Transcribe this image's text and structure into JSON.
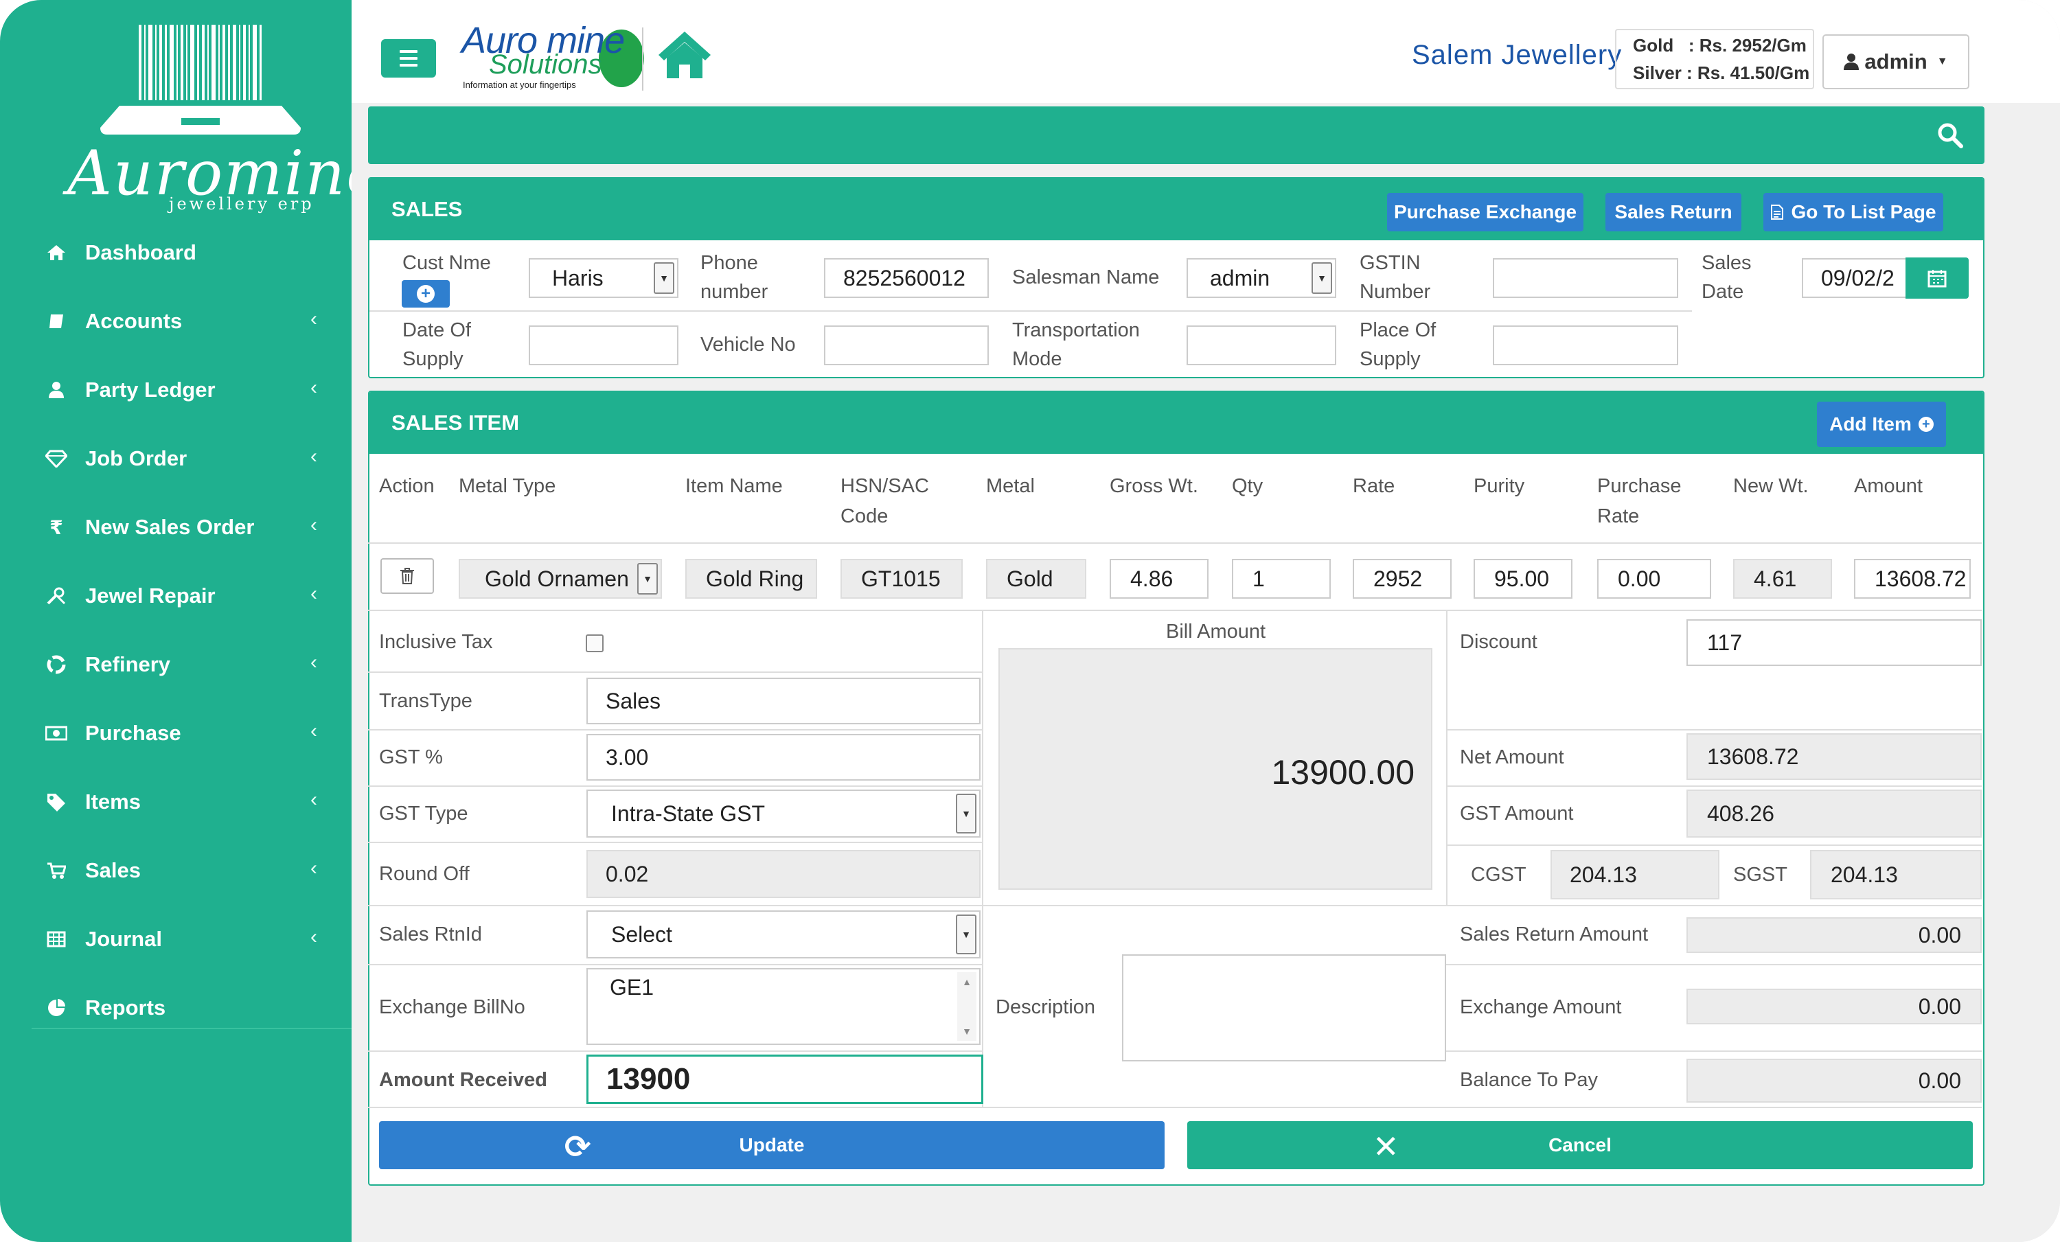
{
  "sidebar": {
    "brand": "Auromine",
    "brand_sub": "jewellery erp",
    "items": [
      {
        "label": "Dashboard",
        "icon": "home-icon"
      },
      {
        "label": "Accounts",
        "icon": "book-icon"
      },
      {
        "label": "Party Ledger",
        "icon": "user-icon"
      },
      {
        "label": "Job Order",
        "icon": "diamond-icon"
      },
      {
        "label": "New Sales Order",
        "icon": "rupee-icon"
      },
      {
        "label": "Jewel Repair",
        "icon": "tools-icon"
      },
      {
        "label": "Refinery",
        "icon": "recycle-icon"
      },
      {
        "label": "Purchase",
        "icon": "money-icon"
      },
      {
        "label": "Items",
        "icon": "tags-icon"
      },
      {
        "label": "Sales",
        "icon": "cart-icon"
      },
      {
        "label": "Journal",
        "icon": "table-icon"
      },
      {
        "label": "Reports",
        "icon": "pie-chart-icon"
      }
    ]
  },
  "header": {
    "logo_line1": "Auro mine",
    "logo_line2": "Solutions",
    "logo_tagline": "Information at your fingertips",
    "shop_name": "Salem Jewellery",
    "gold_rate": "Gold   : Rs. 2952/Gm",
    "silver_rate": "Silver : Rs. 41.50/Gm",
    "user": "admin"
  },
  "sales_panel": {
    "title": "SALES",
    "btn_purchase_exchange": "Purchase Exchange",
    "btn_sales_return": "Sales Return",
    "btn_list_page": "Go To List Page",
    "cust_label": "Cust Nme",
    "cust_value": "Haris",
    "phone_label_1": "Phone",
    "phone_label_2": "number",
    "phone_value": "8252560012",
    "salesman_label": "Salesman Name",
    "salesman_value": "admin",
    "gstin_label_1": "GSTIN",
    "gstin_label_2": "Number",
    "gstin_value": "",
    "sales_date_label_1": "Sales",
    "sales_date_label_2": "Date",
    "sales_date_value": "09/02/2",
    "dos_label_1": "Date Of",
    "dos_label_2": "Supply",
    "dos_value": "",
    "vehicle_label": "Vehicle No",
    "vehicle_value": "",
    "transport_label_1": "Transportation",
    "transport_label_2": "Mode",
    "transport_value": "",
    "place_label_1": "Place Of",
    "place_label_2": "Supply",
    "place_value": ""
  },
  "items_panel": {
    "title": "SALES ITEM",
    "add_item": "Add Item",
    "headers": {
      "action": "Action",
      "metal_type": "Metal Type",
      "item_name": "Item Name",
      "hsn_1": "HSN/SAC",
      "hsn_2": "Code",
      "metal": "Metal",
      "gross": "Gross Wt.",
      "qty": "Qty",
      "rate": "Rate",
      "purity": "Purity",
      "prate_1": "Purchase",
      "prate_2": "Rate",
      "new_wt": "New Wt.",
      "amount": "Amount"
    },
    "row": {
      "metal_type": "Gold Ornamen",
      "item_name": "Gold Ring",
      "hsn": "GT1015",
      "metal": "Gold",
      "gross": "4.86",
      "qty": "1",
      "rate": "2952",
      "purity": "95.00",
      "purchase_rate": "0.00",
      "new_wt": "4.61",
      "amount": "13608.72"
    }
  },
  "summary": {
    "inclusive_tax_label": "Inclusive Tax",
    "inclusive_tax_checked": false,
    "transtype_label": "TransType",
    "transtype_value": "Sales",
    "gst_pct_label": "GST %",
    "gst_pct_value": "3.00",
    "gst_type_label": "GST Type",
    "gst_type_value": "Intra-State GST",
    "round_off_label": "Round Off",
    "round_off_value": "0.02",
    "sales_rtn_label": "Sales RtnId",
    "sales_rtn_value": "Select",
    "exchange_label": "Exchange BillNo",
    "exchange_value": "GE1",
    "amount_received_label": "Amount Received",
    "amount_received_value": "13900",
    "bill_amount_label": "Bill Amount",
    "bill_amount_value": "13900.00",
    "description_label": "Description",
    "description_value": "",
    "discount_label": "Discount",
    "discount_value": "117",
    "net_amount_label": "Net Amount",
    "net_amount_value": "13608.72",
    "gst_amount_label": "GST Amount",
    "gst_amount_value": "408.26",
    "cgst_label": "CGST",
    "cgst_value": "204.13",
    "sgst_label": "SGST",
    "sgst_value": "204.13",
    "sales_return_amount_label": "Sales Return Amount",
    "sales_return_amount_value": "0.00",
    "exchange_amount_label": "Exchange Amount",
    "exchange_amount_value": "0.00",
    "balance_label": "Balance To Pay",
    "balance_value": "0.00",
    "update_label": "Update",
    "cancel_label": "Cancel"
  },
  "colors": {
    "primary": "#1fb08f",
    "button_blue": "#2f7fcf"
  }
}
